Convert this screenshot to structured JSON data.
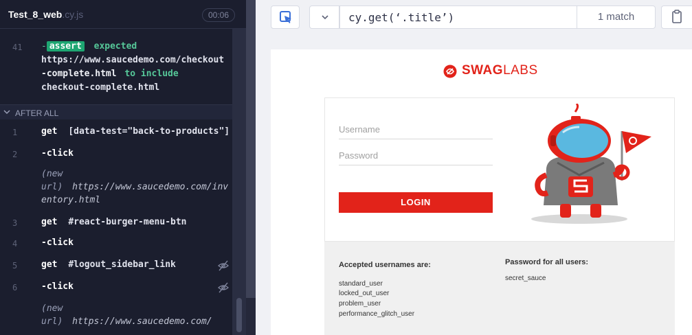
{
  "cmdlog": {
    "spec_name": "Test_8_web",
    "spec_ext": ".cy.js",
    "timer": "00:06",
    "assert_row": {
      "num": "41",
      "dash": "-",
      "badge": "assert",
      "w1": "expected",
      "line2": "https://www.saucedemo.com/checkout",
      "line3a": "-complete.html",
      "line3b": "to include",
      "line4": "checkout-complete.html"
    },
    "after_all_label": "AFTER ALL",
    "commands": [
      {
        "num": "1",
        "cmd": "get",
        "arg": "[data-test=\"back-to-products\"]"
      },
      {
        "num": "2",
        "cmd": "-click",
        "arg": ""
      },
      {
        "num": "3",
        "cmd": "get",
        "arg": "#react-burger-menu-btn"
      },
      {
        "num": "4",
        "cmd": "-click",
        "arg": ""
      },
      {
        "num": "5",
        "cmd": "get",
        "arg": "#logout_sidebar_link"
      },
      {
        "num": "6",
        "cmd": "-click",
        "arg": ""
      }
    ],
    "newurl_1": {
      "l1": "(new",
      "l2a": "url)",
      "l2b": "https://www.saucedemo.com/inv",
      "l3": "entory.html"
    },
    "newurl_2": {
      "l1": "(new",
      "l2a": "url)",
      "l2b": "https://www.saucedemo.com/"
    }
  },
  "playground": {
    "selector_prefix": "cy.get(",
    "selector_value": "‘.title’",
    "selector_suffix": ")",
    "match_count": "1 match"
  },
  "aut": {
    "logo_bold": "SWAG",
    "logo_thin": "LABS",
    "username_placeholder": "Username",
    "password_placeholder": "Password",
    "login_label": "LOGIN",
    "accepted_heading": "Accepted usernames are:",
    "usernames": [
      "standard_user",
      "locked_out_user",
      "problem_user",
      "performance_glitch_user"
    ],
    "password_heading": "Password for all users:",
    "password_value": "secret_sauce"
  },
  "colors": {
    "brand_red": "#e2231a",
    "assert_green": "#1ea672",
    "log_bg": "#1b1e2e"
  }
}
